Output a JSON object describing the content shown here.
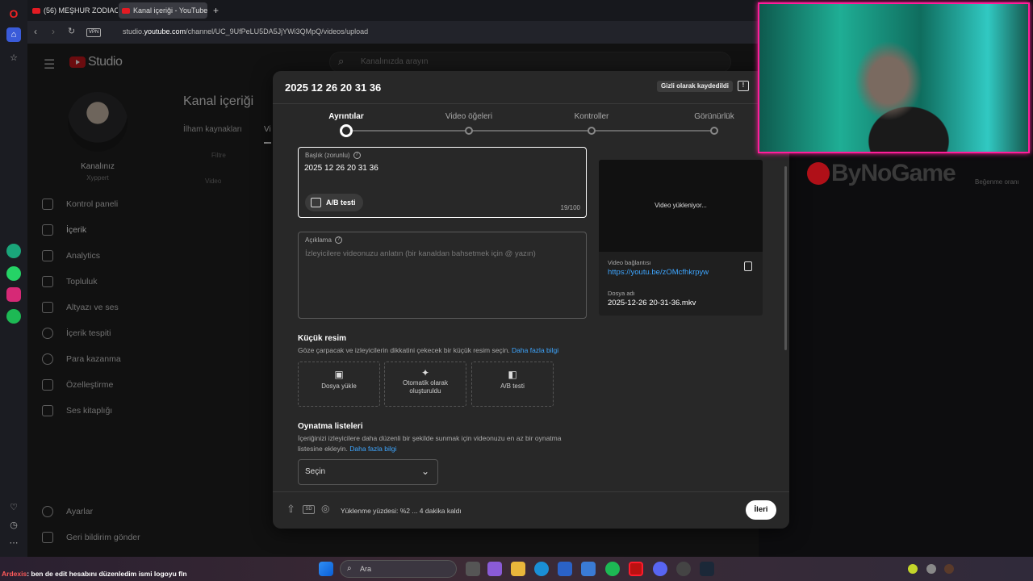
{
  "browser": {
    "tabs": [
      {
        "label": "(56) MEŞHUR ZODIAC VA"
      },
      {
        "label": "Kanal içeriği - YouTube St"
      }
    ],
    "vpn_label": "VPN",
    "url_prefix": "studio.",
    "url_host": "youtube.com",
    "url_path": "/channel/UC_9UfPeLU5DA5JjYWi3QMpQ/videos/upload"
  },
  "studio": {
    "logo_text": "Studio",
    "search_placeholder": "Kanalınızda arayın",
    "channel_name": "Kanalınız",
    "channel_sub": "Xyppert",
    "page_title": "Kanal içeriği",
    "tabs": [
      "İlham kaynakları",
      "Vi"
    ],
    "filter_label": "Filtre",
    "video_col": "Video",
    "nav": [
      {
        "label": "Kontrol paneli"
      },
      {
        "label": "İçerik"
      },
      {
        "label": "Analytics"
      },
      {
        "label": "Topluluk"
      },
      {
        "label": "Altyazı ve ses"
      },
      {
        "label": "İçerik tespiti"
      },
      {
        "label": "Para kazanma"
      },
      {
        "label": "Özelleştirme"
      },
      {
        "label": "Ses kitaplığı"
      }
    ],
    "bottom_nav": [
      {
        "label": "Ayarlar"
      },
      {
        "label": "Geri bildirim gönder"
      }
    ]
  },
  "modal": {
    "title": "2025 12 26 20 31 36",
    "saved_badge": "Gizli olarak kaydedildi",
    "steps": [
      {
        "label": "Ayrıntılar",
        "active": true
      },
      {
        "label": "Video öğeleri",
        "active": false
      },
      {
        "label": "Kontroller",
        "active": false
      },
      {
        "label": "Görünürlük",
        "active": false
      }
    ],
    "title_field": {
      "label": "Başlık (zorunlu)",
      "value": "2025 12 26 20 31 36",
      "counter": "19/100",
      "ab_button": "A/B testi"
    },
    "description_field": {
      "label": "Açıklama",
      "placeholder": "İzleyicilere videonuzu anlatın (bir kanaldan bahsetmek için @ yazın)"
    },
    "thumbnail": {
      "title": "Küçük resim",
      "desc": "Göze çarpacak ve izleyicilerin dikkatini çekecek bir küçük resim seçin.",
      "learn_more": "Daha fazla bilgi",
      "options": [
        {
          "label": "Dosya yükle",
          "icon": "image-upload-icon"
        },
        {
          "label": "Otomatik olarak oluşturuldu",
          "icon": "sparkle-icon"
        },
        {
          "label": "A/B testi",
          "icon": "ab-test-icon"
        }
      ]
    },
    "playlists": {
      "title": "Oynatma listeleri",
      "desc_line1": "İçeriğinizi izleyicilere daha düzenli bir şekilde sunmak için videonuzu en az bir oynatma",
      "desc_line2": "listesine ekleyin.",
      "learn_more": "Daha fazla bilgi",
      "select_value": "Seçin"
    },
    "preview": {
      "loading_text": "Video yükleniyor...",
      "link_label": "Video bağlantısı",
      "link": "https://youtu.be/zOMcfhkrpyw",
      "file_label": "Dosya adı",
      "file_name": "2025-12-26 20-31-36.mkv"
    },
    "footer": {
      "sd_label": "SD",
      "status": "Yüklenme yüzdesi: %2 ... 4 dakika kaldı",
      "next_button": "İleri"
    }
  },
  "overlay": {
    "brand": "ByNoGame",
    "right_text": "Beğenme oranı"
  },
  "taskbar": {
    "chat_user": "Ardexis",
    "chat_message": ": ben de edit hesabını düzenledim ismi logoyu fln",
    "search_placeholder": "Ara"
  },
  "colors": {
    "accent_link": "#3ea6ff",
    "youtube_red": "#e31b23",
    "webcam_border": "#ff1e9a"
  }
}
